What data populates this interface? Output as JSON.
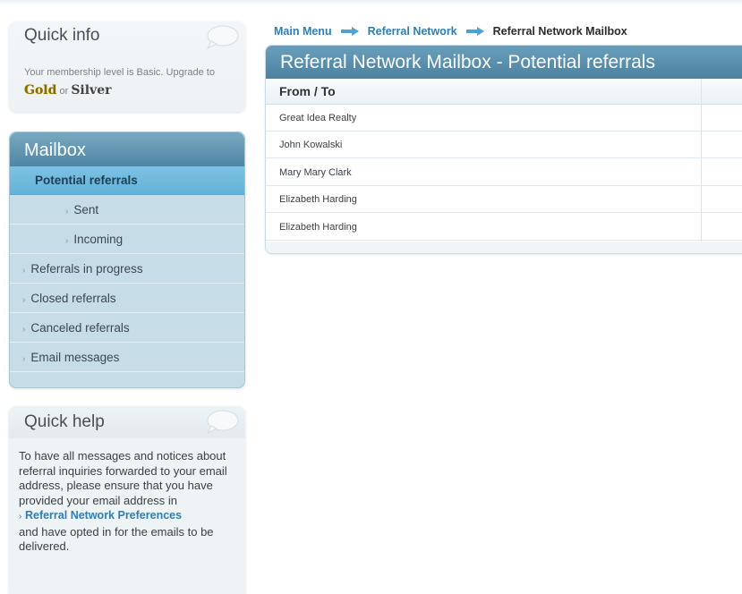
{
  "quick_info": {
    "title": "Quick info",
    "text": "Your membership level is Basic. Upgrade to",
    "gold": "Gold",
    "or": "or",
    "silver": "Silver"
  },
  "mailbox": {
    "title": "Mailbox",
    "items": [
      {
        "label": "Potential referrals",
        "active": true
      },
      {
        "label": "Sent"
      },
      {
        "label": "Incoming"
      },
      {
        "label": "Referrals in progress"
      },
      {
        "label": "Closed referrals"
      },
      {
        "label": "Canceled referrals"
      },
      {
        "label": "Email messages"
      }
    ]
  },
  "quick_help": {
    "title": "Quick help",
    "text_before": "To have all messages and notices about referral inquiries forwarded to your email address, please ensure that you have provided your email address in",
    "link": "Referral Network Preferences",
    "text_after": "and have opted in for the emails to be delivered."
  },
  "breadcrumb": {
    "main_menu": "Main Menu",
    "referral_network": "Referral Network",
    "current": "Referral Network Mailbox"
  },
  "panel": {
    "title": "Referral Network Mailbox - Potential referrals",
    "column_header": "From / To",
    "rows": [
      "Great Idea Realty",
      "John Kowalski",
      "Mary Mary Clark",
      "Elizabeth Harding",
      "Elizabeth Harding"
    ]
  },
  "colors": {
    "accent": "#2f7eb3",
    "header_blue": "#4f86a3",
    "active_item": "#64b2d8"
  }
}
